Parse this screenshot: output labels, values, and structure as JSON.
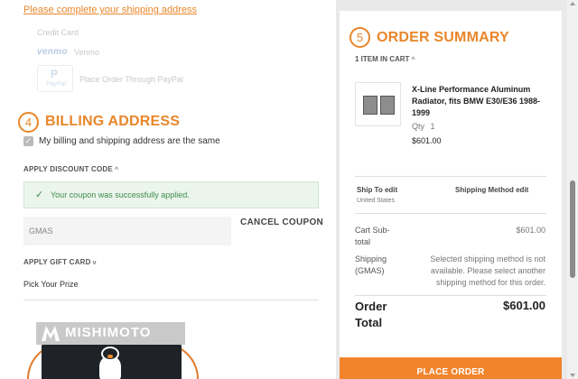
{
  "shipping": {
    "complete_link": "Please complete your shipping address"
  },
  "payment": {
    "credit_card": "Credit Card",
    "venmo_logo": "venmo",
    "venmo": "Venmo",
    "paypal_logo_p": "P",
    "paypal_logo_text": "PayPal",
    "paypal": "Place Order Through PayPal"
  },
  "billing": {
    "step": "4",
    "title": "BILLING ADDRESS",
    "same_address": "My billing and shipping address are the same",
    "same_address_checked": true
  },
  "discount": {
    "label": "APPLY DISCOUNT CODE",
    "success_message": "Your coupon was successfully applied.",
    "code_value": "GMAS",
    "cancel_label": "CANCEL COUPON"
  },
  "gift_card": {
    "label": "APPLY GIFT CARD"
  },
  "prize": {
    "label": "Pick Your Prize",
    "banner_text": "MISHIMOTO"
  },
  "summary": {
    "step": "5",
    "title": "ORDER SUMMARY",
    "items_in_cart": "1 ITEM IN CART",
    "product": {
      "name": "X-Line Performance Aluminum Radiator, fits BMW E30/E36 1988-1999",
      "qty_label": "Qty",
      "qty": "1",
      "price": "$601.00"
    },
    "ship_to_label": "Ship To",
    "ship_to_edit": "edit",
    "ship_to_country": "United States",
    "shipping_method_label": "Shipping Method",
    "shipping_method_edit": "edit",
    "cart_subtotal_label": "Cart Sub-total",
    "cart_subtotal_value": "$601.00",
    "shipping_label": "Shipping (GMAS)",
    "shipping_value": "Selected shipping method is not available. Please select another shipping method for this order.",
    "order_total_label": "Order Total",
    "order_total_value": "$601.00",
    "place_order_label": "PLACE ORDER"
  },
  "colors": {
    "accent": "#e8862a",
    "success": "#3f8b4f",
    "success_bg": "#ebf5ec",
    "page_bg": "#e9e9e9"
  }
}
